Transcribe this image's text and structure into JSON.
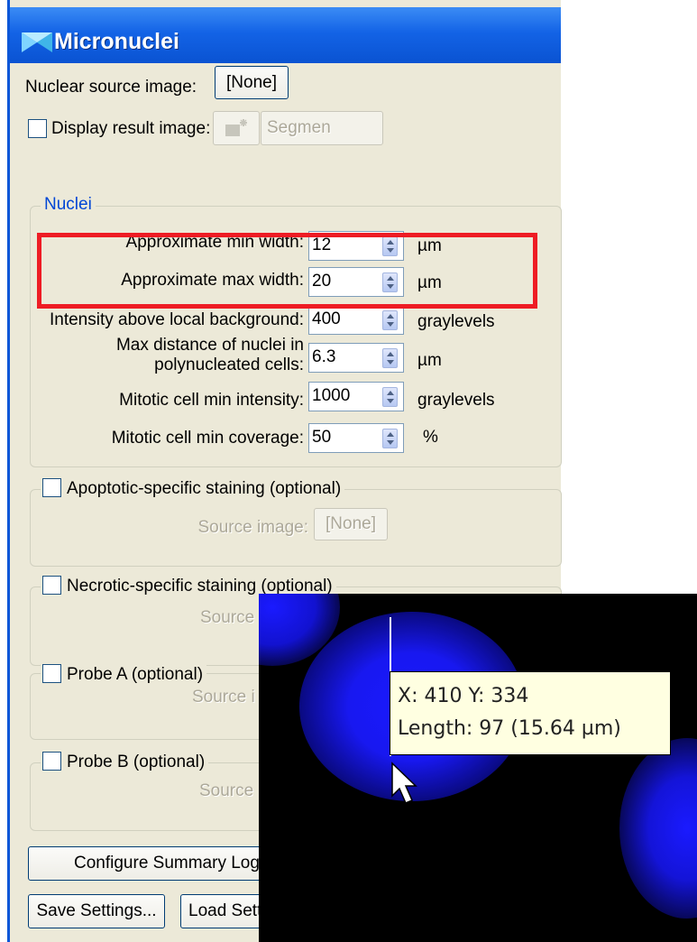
{
  "window": {
    "title": "Micronuclei"
  },
  "source": {
    "label": "Nuclear source image:",
    "button": "[None]"
  },
  "display_result": {
    "label": "Display result image:",
    "segment_button": "Segmen",
    "checked": false
  },
  "nuclei": {
    "legend": "Nuclei",
    "fields": [
      {
        "label": "Approximate min width:",
        "value": "12",
        "unit": "µm"
      },
      {
        "label": "Approximate max width:",
        "value": "20",
        "unit": "µm"
      },
      {
        "label": "Intensity above local background:",
        "value": "400",
        "unit": "graylevels"
      },
      {
        "label_line1": "Max distance of nuclei in",
        "label_line2": "polynucleated cells:",
        "value": "6.3",
        "unit": "µm"
      },
      {
        "label": "Mitotic cell min intensity:",
        "value": "1000",
        "unit": "graylevels"
      },
      {
        "label": "Mitotic cell min coverage:",
        "value": "50",
        "unit": "%"
      }
    ]
  },
  "apoptotic": {
    "legend": "Apoptotic-specific staining (optional)",
    "source_label": "Source image:",
    "source_button": "[None]",
    "checked": false
  },
  "necrotic": {
    "legend": "Necrotic-specific staining (optional)",
    "source_label": "Source",
    "checked": false
  },
  "probe_a": {
    "legend": "Probe A (optional)",
    "source_label": "Source i",
    "checked": false
  },
  "probe_b": {
    "legend": "Probe B (optional)",
    "source_label": "Source i",
    "checked": false
  },
  "buttons": {
    "configure_log": "Configure Summary Log.",
    "save_settings": "Save Settings...",
    "load_settings": "Load Sett"
  },
  "inset": {
    "tooltip_line1": "X: 410  Y: 334",
    "tooltip_line2": "Length: 97 (15.64 µm)"
  },
  "colors": {
    "title_bar": "#0a53d2",
    "dialog_bg": "#ece9d8",
    "group_legend": "#0046d5",
    "highlight": "#ee1c24",
    "nucleus_blue": "#1a1aff",
    "tooltip_bg": "#ffffe1"
  }
}
